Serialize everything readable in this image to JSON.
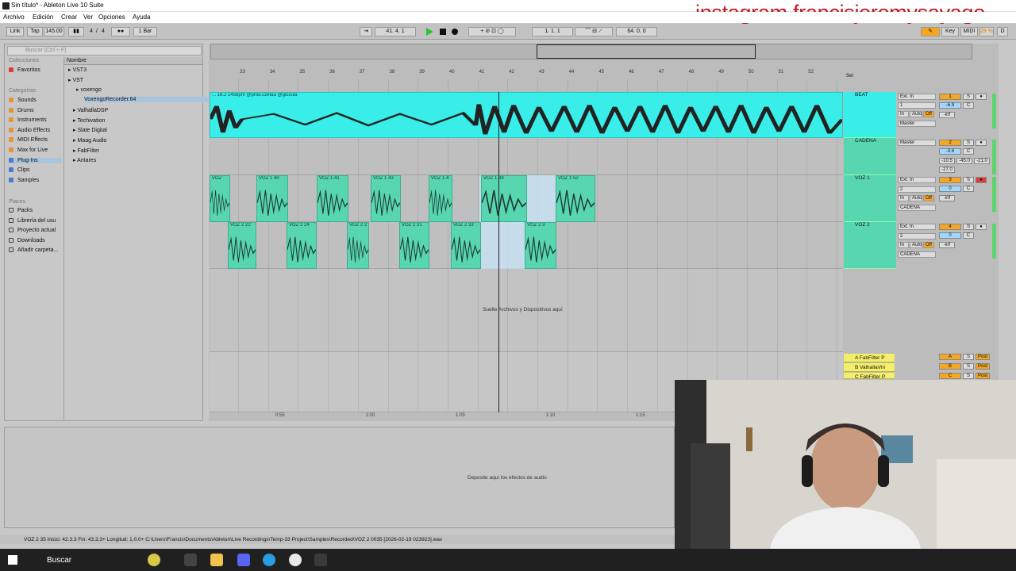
{
  "window": {
    "title": "Sin título* - Ableton Live 10 Suite"
  },
  "menu": [
    "Archivo",
    "Edición",
    "Crear",
    "Ver",
    "Opciones",
    "Ayuda"
  ],
  "watermark": "instagram francisjeremysayago",
  "transport": {
    "link": "Link",
    "tap": "Tap",
    "tempo": "145.00",
    "sig_num": "4",
    "sig_den": "4",
    "quantize": "1 Bar",
    "position": "41.   4.   1",
    "loop_start": "1.   1.   1",
    "loop_length": "64.   0.   0",
    "key": "Key",
    "midi": "MIDI",
    "cpu": "29 %",
    "d_label": "D"
  },
  "browser": {
    "search_placeholder": "Buscar (Ctrl + F)",
    "collections_head": "Colecciones",
    "favorites": "Favoritos",
    "categories_head": "Categorías",
    "categories": [
      "Sounds",
      "Drums",
      "Instruments",
      "Audio Effects",
      "MIDI Effects",
      "Max for Live",
      "Plug-Ins",
      "Clips",
      "Samples"
    ],
    "places_head": "Places",
    "places": [
      "Packs",
      "Librería del usu",
      "Proyecto actual",
      "Downloads",
      "Añadir carpeta..."
    ],
    "column_head": "Nombre",
    "items": [
      "VST3",
      "VST",
      "voxengo",
      "VoxengoRecorder.64",
      "ValhallaDSP",
      "Techivation",
      "Slate Digital",
      "Maag Audio",
      "FabFilter",
      "Antares"
    ]
  },
  "ruler": {
    "bars": [
      "33",
      "34",
      "35",
      "36",
      "37",
      "38",
      "39",
      "40",
      "41",
      "42",
      "43",
      "44",
      "45",
      "46",
      "47",
      "48",
      "49",
      "50",
      "51",
      "52"
    ],
    "set": "Set"
  },
  "tracks": [
    {
      "name": "BEAT",
      "input": "Ext. In",
      "channel": "1",
      "monitor_in": "In",
      "monitor_auto": "Auto",
      "monitor_off": "Off",
      "output": "Master",
      "number": "1",
      "vol": "-6.9",
      "pan": "C",
      "peak": "-inf",
      "s": "S"
    },
    {
      "name": "CADENA",
      "input": "Master",
      "number": "2",
      "vol": "-3.6",
      "pan": "C",
      "send_a": "-10.5",
      "send_b": "-45.0",
      "send_c": "-21.0",
      "peak": "-27.0",
      "s": "S"
    },
    {
      "name": "VOZ 1",
      "input": "Ext. In",
      "channel": "2",
      "monitor_in": "In",
      "monitor_auto": "Auto",
      "monitor_off": "Off",
      "output": "CADENA",
      "number": "3",
      "vol": "0",
      "pan": "C",
      "peak": "-inf",
      "s": "S"
    },
    {
      "name": "VOZ 2",
      "input": "Ext. In",
      "channel": "2",
      "monitor_in": "In",
      "monitor_auto": "Auto",
      "monitor_off": "Off",
      "output": "CADENA",
      "number": "4",
      "vol": "0",
      "pan": "C",
      "peak": "-inf",
      "s": "S"
    }
  ],
  "return_tracks": [
    {
      "name": "A FabFilter P",
      "letter": "A",
      "post": "Post",
      "s": "S"
    },
    {
      "name": "B ValhallaVin",
      "letter": "B",
      "post": "Post",
      "s": "S"
    },
    {
      "name": "C FabFilter P",
      "letter": "C",
      "post": "Post",
      "s": "S"
    }
  ],
  "clips": {
    "beat": "... 18.2 145bpm @prod.czetaa @giozula",
    "voz1": [
      "VOZ",
      "VOZ 1 40",
      "VOZ 1 41",
      "VOZ 1 43",
      "VOZ 1 4",
      "VOZ 1 39",
      "VOZ 1 52"
    ],
    "voz2": [
      "VOZ 2 22",
      "VOZ 2 24",
      "VOZ 2 2",
      "VOZ 2 31",
      "VOZ 2 33",
      "VOZ 2 3"
    ]
  },
  "drop_text": "Suelte Archivos y Dispositivos aquí",
  "timeline": [
    "0:55",
    "1:00",
    "1:05",
    "1:10",
    "1:15"
  ],
  "device_drop": "Deposite aquí los efectos de audio",
  "status": "VOZ 2 35  Inicio: 42.3.3  Fin: 43.3.3+  Longitud: 1.0.0+  C:\\Users\\Francis\\Documents\\Ableton\\Live Recordings\\Temp-33 Project\\Samples\\Recorded\\VOZ 2 0035 [2026-02-19 023923].wav",
  "taskbar": {
    "search": "Buscar"
  },
  "colors": {
    "beat_clip": "#39eee8",
    "voice_clip": "#58d6b0",
    "accent_orange": "#f5a623",
    "record_red": "#e23b3b",
    "play_green": "#27c52f"
  }
}
